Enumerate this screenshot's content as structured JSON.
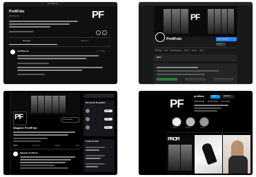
{
  "panel1": {
    "url": "profifoto.de",
    "name": "ProfiFoto",
    "handle": "profifoto.de",
    "logo": "PF",
    "tabs": [
      "Beiträge",
      "Markiert"
    ],
    "post_author": "profifoto.de",
    "time": "vor 2 Std."
  },
  "panel2": {
    "logo": "PF",
    "page_name": "ProfiFoto",
    "nav": [
      "Beiträge",
      "Info",
      "Erwähnungen",
      "Fotos",
      "Videos",
      "Mehr"
    ],
    "primary_button": "Nachricht senden",
    "secondary_button": "Gefällt mir",
    "intro": "Intro"
  },
  "panel3": {
    "logo": "PF",
    "account_name": "Magazin ProfiFoto",
    "follow_button": "Folgen",
    "profile_button": "Profil bearbeiten",
    "sidebar_title": "Das könnte dir gefallen",
    "follow_labels": [
      "Folgen",
      "Folgen",
      "Folgen"
    ],
    "trends_title": "Trends für dich",
    "tabs": [
      "Posts",
      "Antworten",
      "Medien",
      "Likes"
    ],
    "tweet_author": "Magazin ProfiFoto"
  },
  "panel4": {
    "logo": "PF",
    "username": "profifoto",
    "stats": [
      "3.891 Beiträge",
      "12.4K Follower",
      "512 Gefolgt"
    ],
    "follow_button": "Folgen",
    "message_button": "Nachricht",
    "highlights": [
      "Cover",
      "Events",
      "Team"
    ],
    "tile_logo": "PROFI"
  }
}
